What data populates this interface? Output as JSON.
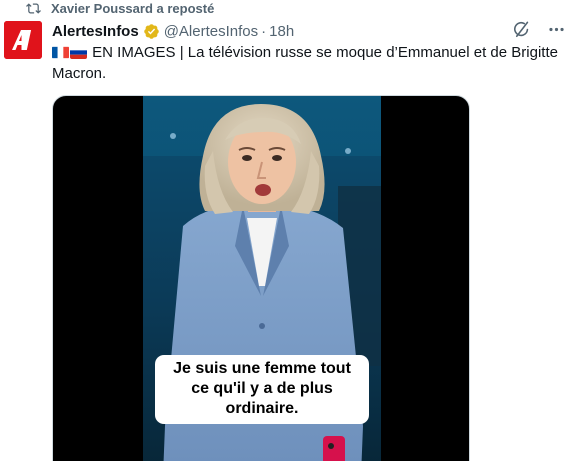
{
  "repost": {
    "icon": "repost-icon",
    "label": "Xavier Poussard a reposté"
  },
  "author": {
    "avatar_icon": "alertesinfos-logo-icon",
    "name": "AlertesInfos",
    "verified_icon": "verified-badge-icon",
    "handle": "@AlertesInfos",
    "separator": "·",
    "timestamp": "18h"
  },
  "actions": {
    "grok_icon": "grok-icon",
    "more_icon": "more-options-icon"
  },
  "tweet": {
    "flag_fr": "french-flag-icon",
    "flag_ru": "russian-flag-icon",
    "text": "EN IMAGES | La télévision russe se moque d’Emmanuel et de Brigitte Macron."
  },
  "media": {
    "caption": "Je suis une femme tout ce qu'il y a de plus ordinaire."
  },
  "colors": {
    "accent_red": "#e0131b",
    "muted": "#536471",
    "verified_gold": "#e2b719"
  }
}
